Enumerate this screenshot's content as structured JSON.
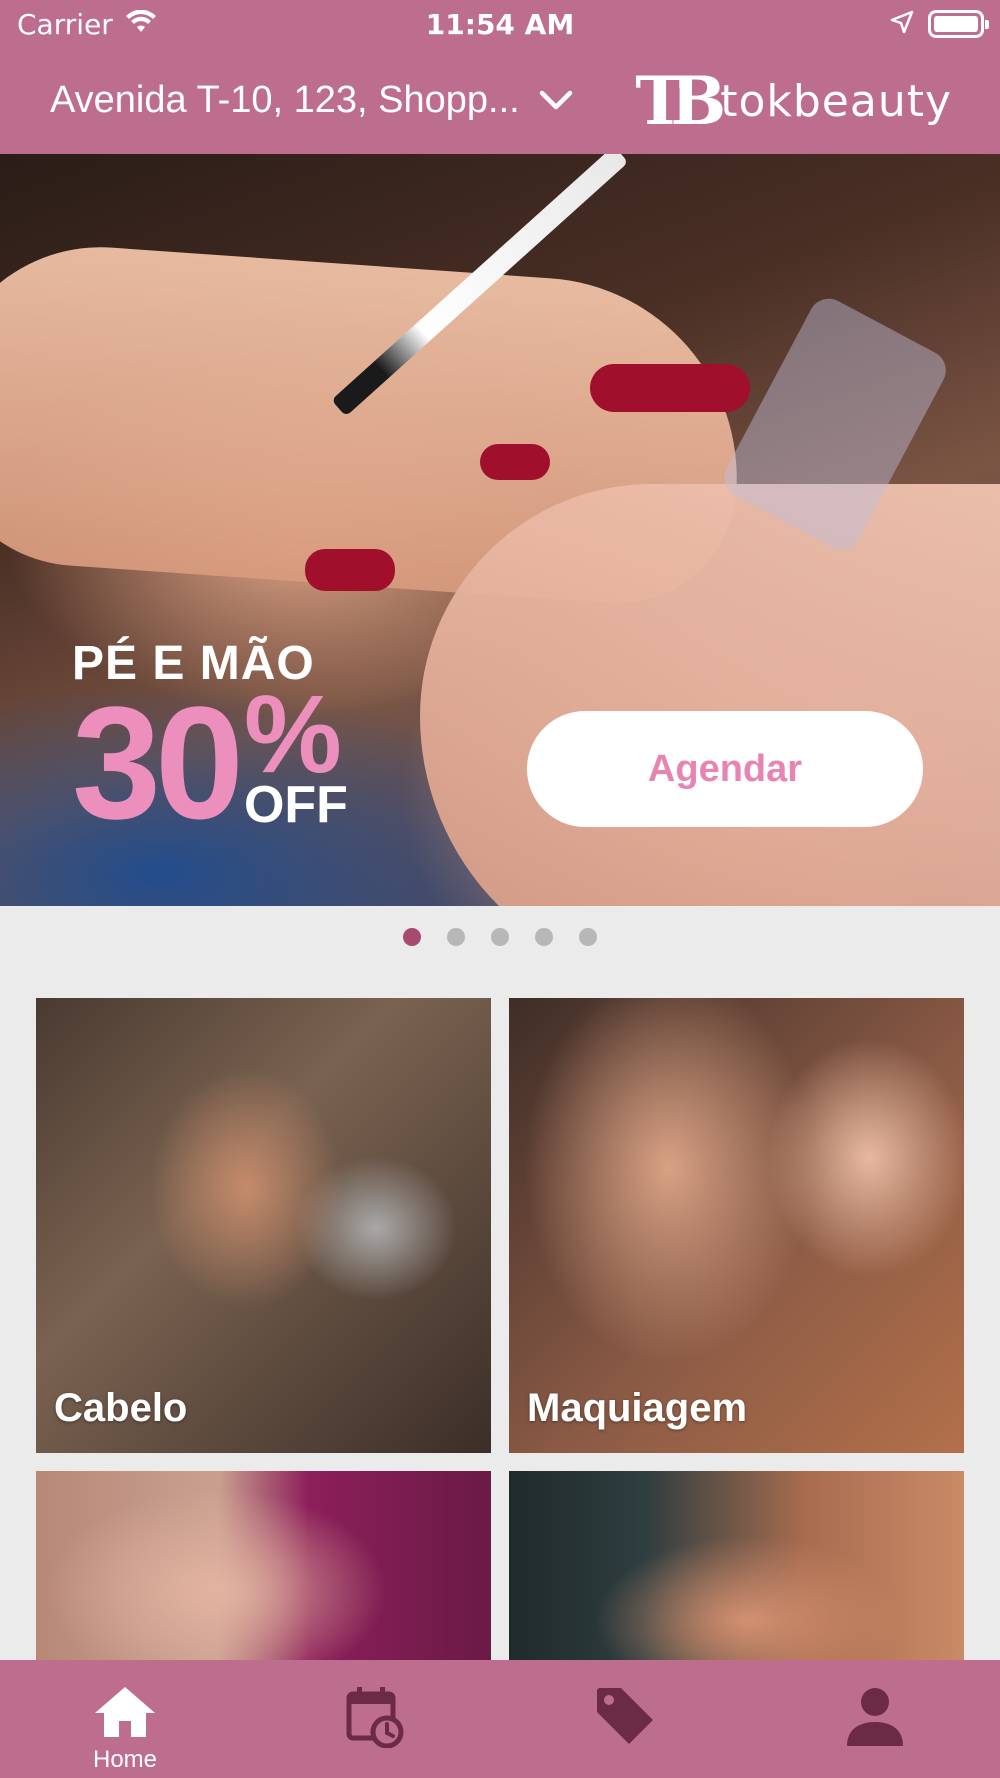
{
  "status_bar": {
    "carrier": "Carrier",
    "time": "11:54 AM"
  },
  "header": {
    "address": "Avenida T-10, 123, Shopp...",
    "logo_mark": "TB",
    "logo_text": "tokbeauty"
  },
  "banner": {
    "promo_line": "PÉ E MÃO",
    "discount": "30",
    "percent": "%",
    "off": "OFF",
    "cta_label": "Agendar"
  },
  "carousel": {
    "count": 5,
    "active_index": 0
  },
  "categories": [
    {
      "label": "Cabelo"
    },
    {
      "label": "Maquiagem"
    },
    {
      "label": ""
    },
    {
      "label": ""
    }
  ],
  "tabbar": {
    "items": [
      {
        "icon": "home-icon",
        "label": "Home",
        "active": true
      },
      {
        "icon": "calendar-clock-icon",
        "label": "",
        "active": false
      },
      {
        "icon": "tag-icon",
        "label": "",
        "active": false
      },
      {
        "icon": "person-icon",
        "label": "",
        "active": false
      }
    ]
  },
  "colors": {
    "brand": "#bd6e8f",
    "accent_pink": "#ec8fbd",
    "active_dot": "#a64a6f",
    "inactive_icon": "#6b2a45"
  }
}
